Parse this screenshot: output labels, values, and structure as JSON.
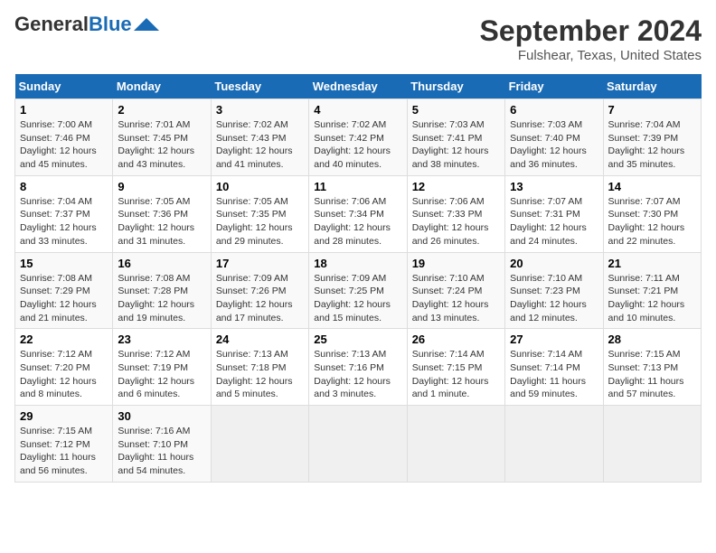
{
  "header": {
    "logo_line1": "General",
    "logo_line2": "Blue",
    "title": "September 2024",
    "subtitle": "Fulshear, Texas, United States"
  },
  "calendar": {
    "days_of_week": [
      "Sunday",
      "Monday",
      "Tuesday",
      "Wednesday",
      "Thursday",
      "Friday",
      "Saturday"
    ],
    "weeks": [
      [
        {
          "day": 1,
          "sunrise": "7:00 AM",
          "sunset": "7:46 PM",
          "daylight": "12 hours and 45 minutes."
        },
        {
          "day": 2,
          "sunrise": "7:01 AM",
          "sunset": "7:45 PM",
          "daylight": "12 hours and 43 minutes."
        },
        {
          "day": 3,
          "sunrise": "7:02 AM",
          "sunset": "7:43 PM",
          "daylight": "12 hours and 41 minutes."
        },
        {
          "day": 4,
          "sunrise": "7:02 AM",
          "sunset": "7:42 PM",
          "daylight": "12 hours and 40 minutes."
        },
        {
          "day": 5,
          "sunrise": "7:03 AM",
          "sunset": "7:41 PM",
          "daylight": "12 hours and 38 minutes."
        },
        {
          "day": 6,
          "sunrise": "7:03 AM",
          "sunset": "7:40 PM",
          "daylight": "12 hours and 36 minutes."
        },
        {
          "day": 7,
          "sunrise": "7:04 AM",
          "sunset": "7:39 PM",
          "daylight": "12 hours and 35 minutes."
        }
      ],
      [
        {
          "day": 8,
          "sunrise": "7:04 AM",
          "sunset": "7:37 PM",
          "daylight": "12 hours and 33 minutes."
        },
        {
          "day": 9,
          "sunrise": "7:05 AM",
          "sunset": "7:36 PM",
          "daylight": "12 hours and 31 minutes."
        },
        {
          "day": 10,
          "sunrise": "7:05 AM",
          "sunset": "7:35 PM",
          "daylight": "12 hours and 29 minutes."
        },
        {
          "day": 11,
          "sunrise": "7:06 AM",
          "sunset": "7:34 PM",
          "daylight": "12 hours and 28 minutes."
        },
        {
          "day": 12,
          "sunrise": "7:06 AM",
          "sunset": "7:33 PM",
          "daylight": "12 hours and 26 minutes."
        },
        {
          "day": 13,
          "sunrise": "7:07 AM",
          "sunset": "7:31 PM",
          "daylight": "12 hours and 24 minutes."
        },
        {
          "day": 14,
          "sunrise": "7:07 AM",
          "sunset": "7:30 PM",
          "daylight": "12 hours and 22 minutes."
        }
      ],
      [
        {
          "day": 15,
          "sunrise": "7:08 AM",
          "sunset": "7:29 PM",
          "daylight": "12 hours and 21 minutes."
        },
        {
          "day": 16,
          "sunrise": "7:08 AM",
          "sunset": "7:28 PM",
          "daylight": "12 hours and 19 minutes."
        },
        {
          "day": 17,
          "sunrise": "7:09 AM",
          "sunset": "7:26 PM",
          "daylight": "12 hours and 17 minutes."
        },
        {
          "day": 18,
          "sunrise": "7:09 AM",
          "sunset": "7:25 PM",
          "daylight": "12 hours and 15 minutes."
        },
        {
          "day": 19,
          "sunrise": "7:10 AM",
          "sunset": "7:24 PM",
          "daylight": "12 hours and 13 minutes."
        },
        {
          "day": 20,
          "sunrise": "7:10 AM",
          "sunset": "7:23 PM",
          "daylight": "12 hours and 12 minutes."
        },
        {
          "day": 21,
          "sunrise": "7:11 AM",
          "sunset": "7:21 PM",
          "daylight": "12 hours and 10 minutes."
        }
      ],
      [
        {
          "day": 22,
          "sunrise": "7:12 AM",
          "sunset": "7:20 PM",
          "daylight": "12 hours and 8 minutes."
        },
        {
          "day": 23,
          "sunrise": "7:12 AM",
          "sunset": "7:19 PM",
          "daylight": "12 hours and 6 minutes."
        },
        {
          "day": 24,
          "sunrise": "7:13 AM",
          "sunset": "7:18 PM",
          "daylight": "12 hours and 5 minutes."
        },
        {
          "day": 25,
          "sunrise": "7:13 AM",
          "sunset": "7:16 PM",
          "daylight": "12 hours and 3 minutes."
        },
        {
          "day": 26,
          "sunrise": "7:14 AM",
          "sunset": "7:15 PM",
          "daylight": "12 hours and 1 minute."
        },
        {
          "day": 27,
          "sunrise": "7:14 AM",
          "sunset": "7:14 PM",
          "daylight": "11 hours and 59 minutes."
        },
        {
          "day": 28,
          "sunrise": "7:15 AM",
          "sunset": "7:13 PM",
          "daylight": "11 hours and 57 minutes."
        }
      ],
      [
        {
          "day": 29,
          "sunrise": "7:15 AM",
          "sunset": "7:12 PM",
          "daylight": "11 hours and 56 minutes."
        },
        {
          "day": 30,
          "sunrise": "7:16 AM",
          "sunset": "7:10 PM",
          "daylight": "11 hours and 54 minutes."
        },
        null,
        null,
        null,
        null,
        null
      ]
    ]
  }
}
